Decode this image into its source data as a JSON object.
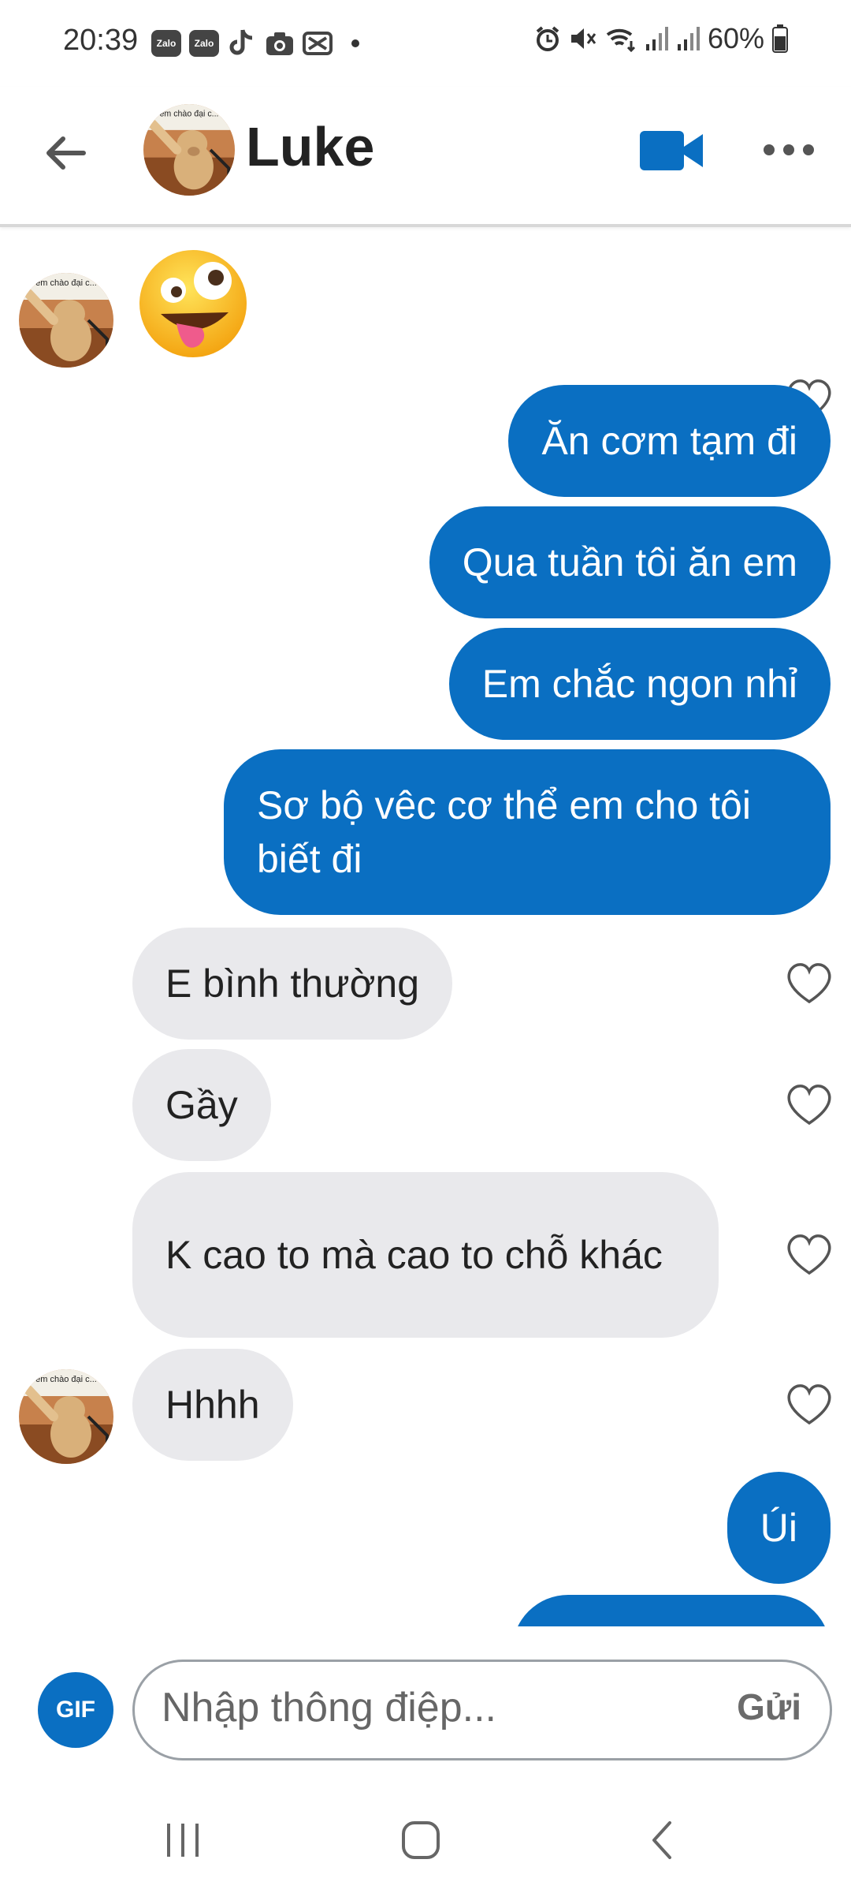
{
  "status_bar": {
    "time": "20:39",
    "notif_icons": [
      "zalo-icon",
      "zalo-icon",
      "tiktok-icon",
      "camera-icon",
      "capcut-icon"
    ],
    "zalo_label": "Zalo",
    "right_icons": [
      "alarm-icon",
      "mute-icon",
      "wifi-icon",
      "signal-icon",
      "signal-icon"
    ],
    "battery": "60%"
  },
  "header": {
    "contact_name": "Luke",
    "avatar_caption": "em chào đại c..."
  },
  "messages": [
    {
      "dir": "in",
      "type": "emoji",
      "emoji": "zany-face"
    },
    {
      "dir": "out",
      "text": "Ăn cơm tạm đi"
    },
    {
      "dir": "out",
      "text": "Qua tuần tôi ăn em"
    },
    {
      "dir": "out",
      "text": "Em chắc ngon nhỉ"
    },
    {
      "dir": "out",
      "text": "Sơ bộ vêc cơ thể em cho tôi biết đi"
    },
    {
      "dir": "in",
      "text": "E bình thường"
    },
    {
      "dir": "in",
      "text": "Gầy"
    },
    {
      "dir": "in",
      "text": "K cao to mà cao to chỗ khác"
    },
    {
      "dir": "in",
      "text": "Hhhh"
    },
    {
      "dir": "out",
      "text": "Úi"
    }
  ],
  "input": {
    "gif_label": "GIF",
    "placeholder": "Nhập thông điệp...",
    "send_label": "Gửi"
  },
  "colors": {
    "accent": "#0a6fc2",
    "incoming_bubble": "#e9e9ec",
    "outgoing_text": "#ffffff"
  }
}
